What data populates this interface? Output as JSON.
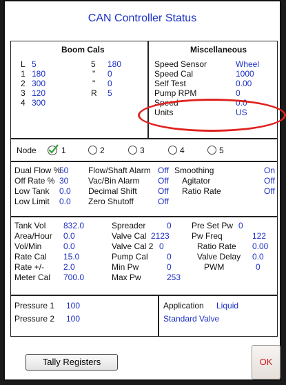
{
  "window": {
    "title": "CAN Controller Status"
  },
  "boom_cals": {
    "header": "Boom Cals",
    "rows": [
      {
        "label": "L",
        "value": "5",
        "label2": "5",
        "value2": "180"
      },
      {
        "label": "1",
        "value": "180",
        "label2": "\"",
        "value2": "0"
      },
      {
        "label": "2",
        "value": "300",
        "label2": "\"",
        "value2": "0"
      },
      {
        "label": "3",
        "value": "120",
        "label2": "R",
        "value2": "5"
      },
      {
        "label": "4",
        "value": "300",
        "label2": "",
        "value2": ""
      }
    ]
  },
  "misc": {
    "header": "Miscellaneous",
    "rows": [
      {
        "label": "Speed Sensor",
        "value": "Wheel"
      },
      {
        "label": "Speed Cal",
        "value": "1000"
      },
      {
        "label": "Self Test",
        "value": "0.00"
      },
      {
        "label": "Pump RPM",
        "value": "0"
      },
      {
        "label": "Speed",
        "value": "0.0"
      },
      {
        "label": "Units",
        "value": "US"
      }
    ]
  },
  "node": {
    "label": "Node",
    "options": [
      "1",
      "2",
      "3",
      "4",
      "5"
    ],
    "selected": "1"
  },
  "settings": {
    "dual_flow_label": "Dual Flow %",
    "dual_flow": "50",
    "off_rate_label": "Off Rate %",
    "off_rate": "30",
    "low_tank_label": "Low Tank",
    "low_tank": "0.0",
    "low_limit_label": "Low Limit",
    "low_limit": "0.0",
    "flow_shaft_label": "Flow/Shaft Alarm",
    "flow_shaft": "Off",
    "vac_bin_label": "Vac/Bin Alarm",
    "vac_bin": "Off",
    "decimal_shift_label": "Decimal Shift",
    "decimal_shift": "Off",
    "zero_shutoff_label": "Zero Shutoff",
    "zero_shutoff": "Off",
    "smoothing_label": "Smoothing",
    "smoothing": "On",
    "agitator_label": "Agitator",
    "agitator": "Off",
    "ratio_rate_label": "Ratio Rate",
    "ratio_rate": "Off"
  },
  "cal": {
    "tank_vol_label": "Tank Vol",
    "tank_vol": "832.0",
    "area_hour_label": "Area/Hour",
    "area_hour": "0.0",
    "vol_min_label": "Vol/Min",
    "vol_min": "0.0",
    "rate_cal_label": "Rate Cal",
    "rate_cal": "15.0",
    "rate_pm_label": "Rate +/-",
    "rate_pm": "2.0",
    "meter_cal_label": "Meter Cal",
    "meter_cal": "700.0",
    "spreader_label": "Spreader",
    "spreader": "0",
    "valve_cal_label": "Valve Cal",
    "valve_cal": "2123",
    "valve_cal2_label": "Valve Cal 2",
    "valve_cal2": "0",
    "pump_cal_label": "Pump Cal",
    "pump_cal": "0",
    "min_pw_label": "Min Pw",
    "min_pw": "0",
    "max_pw_label": "Max Pw",
    "max_pw": "253",
    "pre_set_pw_label": "Pre Set Pw",
    "pre_set_pw": "0",
    "pw_freq_label": "Pw Freq",
    "pw_freq": "122",
    "ratio_rate_label": "Ratio Rate",
    "ratio_rate": "0.00",
    "valve_delay_label": "Valve Delay",
    "valve_delay": "0.0",
    "pwm_label": "PWM",
    "pwm": "0"
  },
  "pressure": {
    "p1_label": "Pressure 1",
    "p1": "100",
    "p2_label": "Pressure 2",
    "p2": "100",
    "application_label": "Application",
    "application": "Liquid",
    "valve_type": "Standard Valve"
  },
  "buttons": {
    "tally": "Tally Registers",
    "ok": "OK"
  },
  "colors": {
    "value_blue": "#1c2fc4",
    "ok_red": "#cc1a1a",
    "highlight_oval": "#e0231f"
  }
}
